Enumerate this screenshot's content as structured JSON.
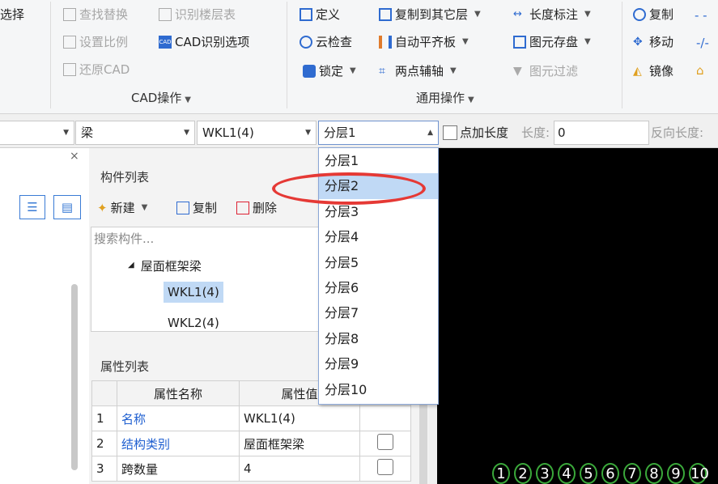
{
  "ribbon": {
    "col0": [
      "选择"
    ],
    "col1": [
      {
        "label": "查找替换",
        "disabled": true,
        "icon": "find-replace-icon"
      },
      {
        "label": "设置比例",
        "disabled": true,
        "icon": "scale-icon"
      },
      {
        "label": "还原CAD",
        "disabled": true,
        "icon": "restore-cad-icon"
      }
    ],
    "col2": [
      {
        "label": "识别楼层表",
        "disabled": true,
        "icon": "floor-table-icon"
      },
      {
        "label": "CAD识别选项",
        "disabled": false,
        "icon": "cad-options-icon"
      }
    ],
    "cad_group_label": "CAD操作",
    "col3": [
      {
        "label": "定义",
        "icon": "define-icon"
      },
      {
        "label": "云检查",
        "icon": "cloud-check-icon"
      },
      {
        "label": "锁定",
        "icon": "lock-icon",
        "dropdown": true
      }
    ],
    "col4": [
      {
        "label": "复制到其它层",
        "icon": "copy-to-layer-icon",
        "dropdown": true
      },
      {
        "label": "自动平齐板",
        "icon": "auto-align-icon",
        "dropdown": true
      },
      {
        "label": "两点辅轴",
        "icon": "two-point-axis-icon",
        "dropdown": true
      }
    ],
    "col5": [
      {
        "label": "长度标注",
        "icon": "length-dimension-icon",
        "dropdown": true
      },
      {
        "label": "图元存盘",
        "icon": "element-save-icon",
        "dropdown": true
      },
      {
        "label": "图元过滤",
        "icon": "element-filter-icon",
        "disabled": true
      }
    ],
    "general_group_label": "通用操作",
    "col6": [
      {
        "label": "复制",
        "icon": "copy-icon"
      },
      {
        "label": "移动",
        "icon": "move-icon"
      },
      {
        "label": "镜像",
        "icon": "mirror-icon"
      }
    ]
  },
  "toolbar": {
    "combo_type": "梁",
    "combo_element": "WKL1(4)",
    "combo_layer": "分层1",
    "checkbox_label": "点加长度",
    "length_label": "长度:",
    "length_value": "0",
    "reverse_length_label": "反向长度:"
  },
  "component_list": {
    "title": "构件列表",
    "new_label": "新建",
    "copy_label": "复制",
    "delete_label": "删除",
    "search_placeholder": "搜索构件...",
    "tree_group": "屋面框架梁",
    "items": [
      "WKL1(4)",
      "WKL2(4)"
    ]
  },
  "property_list": {
    "title": "属性列表",
    "col_name": "属性名称",
    "col_value": "属性值",
    "rows": [
      {
        "idx": "1",
        "name": "名称",
        "value": "WKL1(4)",
        "blue": true
      },
      {
        "idx": "2",
        "name": "结构类别",
        "value": "屋面框架梁",
        "blue": true
      },
      {
        "idx": "3",
        "name": "跨数量",
        "value": "4",
        "blue": false
      }
    ]
  },
  "dropdown": {
    "options": [
      "分层1",
      "分层2",
      "分层3",
      "分层4",
      "分层5",
      "分层6",
      "分层7",
      "分层8",
      "分层9",
      "分层10"
    ],
    "hovered_index": 1
  },
  "axis_labels": [
    "1",
    "2",
    "3",
    "4",
    "5",
    "6",
    "7",
    "8",
    "9",
    "10"
  ],
  "colors": {
    "accent": "#1f5fd0",
    "highlight": "#c0d9f5",
    "annotation": "#e53935",
    "axis": "#3aa83a"
  }
}
